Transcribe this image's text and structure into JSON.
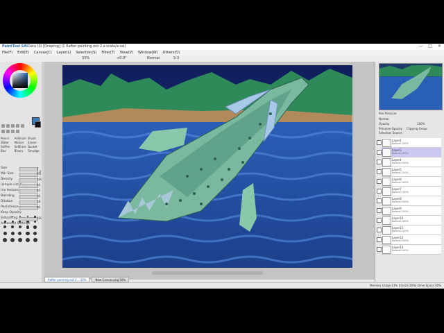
{
  "app": {
    "logo": "PaintTool SAI",
    "title": "Data (0) [Drawing] (1 Rafter painting out 2.a scale/a.sai)",
    "window_buttons": [
      "—",
      "□",
      "✕"
    ]
  },
  "menu": [
    "File(F)",
    "Edit(E)",
    "Canvas(C)",
    "Layer(L)",
    "Selection(S)",
    "Filter(T)",
    "View(V)",
    "Window(W)",
    "Others(O)"
  ],
  "toolbar": {
    "zoom": "33%",
    "rotation": "+0.0°",
    "mode": "Normal",
    "stabilizer": "S-3"
  },
  "tools": {
    "modes": [
      "Pencil",
      "AirBrush",
      "Brush",
      "Water",
      "Marker",
      "Eraser",
      "SelPen",
      "SelErase",
      "Bucket",
      "Blur",
      "Binary",
      "Smudge"
    ],
    "properties": [
      {
        "label": "Size",
        "value": "x 1.0"
      },
      {
        "label": "Min Size",
        "value": "0%"
      },
      {
        "label": "Density",
        "value": "100"
      },
      {
        "label": "(simple circle)",
        "value": "50"
      },
      {
        "label": "(no texture)",
        "value": "95"
      },
      {
        "label": "Blending",
        "value": "30"
      },
      {
        "label": "Dilution",
        "value": "58"
      },
      {
        "label": "Persistence",
        "value": "80"
      },
      {
        "label": "Keep Opacity",
        "value": ""
      },
      {
        "label": "Smoothing",
        "value": "100%"
      },
      {
        "label": "Advanced Settings",
        "value": ""
      }
    ]
  },
  "tabs": [
    {
      "label": "Rafter painting out 2...",
      "zoom": "33%"
    },
    {
      "label": "New Canvas.png",
      "zoom": "50%"
    }
  ],
  "status": "Memory Usage 13% (Use23 20%)  Drive Space 00%",
  "layers_panel": {
    "pen_pressure": "Pen Pressure",
    "mode": "Normal",
    "opacity_label": "Opacity",
    "opacity": "100%",
    "preserve_opacity": "Preserve Opacity",
    "clipping_group": "Clipping Group",
    "selection_source": "Selection Source"
  },
  "layers": [
    {
      "name": "Layer2",
      "mode": "Normal 100%"
    },
    {
      "name": "Layer3",
      "mode": "Normal 100%"
    },
    {
      "name": "Layer4",
      "mode": "Normal 100%"
    },
    {
      "name": "Layer5",
      "mode": "Normal 100%"
    },
    {
      "name": "Layer6",
      "mode": "Normal 100%"
    },
    {
      "name": "Layer7",
      "mode": "Normal 100%"
    },
    {
      "name": "Layer8",
      "mode": "Normal 100%"
    },
    {
      "name": "Layer9",
      "mode": "Normal 100%"
    },
    {
      "name": "Layer10",
      "mode": "Normal 100%"
    },
    {
      "name": "Layer11",
      "mode": "Normal 100%"
    },
    {
      "name": "Layer12",
      "mode": "Normal 100%"
    },
    {
      "name": "Layer13",
      "mode": "Normal 100%"
    }
  ],
  "colors": {
    "sky_top": "#0f1d5a",
    "sky_bottom": "#2a4aa0",
    "mountains": "#2f8a5a",
    "sand": "#b08a5a",
    "water": "#2a5fb8",
    "creature": "#7ab8a0",
    "spots": "#2d5f50",
    "fins": "#a8c8e8",
    "primary_swatch": "#3a7fb8",
    "secondary_swatch": "#111111"
  }
}
